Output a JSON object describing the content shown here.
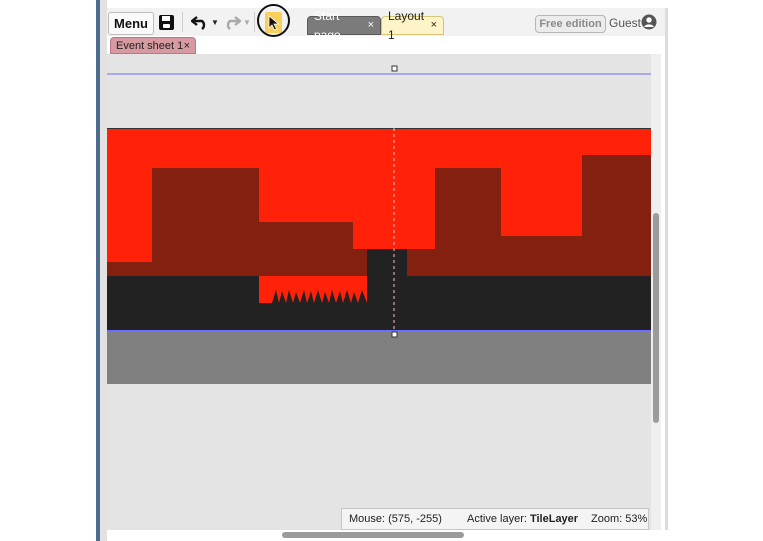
{
  "toolbar": {
    "menu_label": "Menu",
    "tabs": [
      {
        "label": "Start page",
        "close": "×"
      },
      {
        "label": "Layout 1",
        "close": "×"
      }
    ],
    "edition_badge": "Free edition",
    "user_label": "Guest"
  },
  "sheet_tabs": [
    {
      "label": "Event sheet 1",
      "close": "×"
    }
  ],
  "status": {
    "mouse": "Mouse: (575, -255)",
    "active_layer_label": "Active layer: ",
    "active_layer_value": "TileLayer",
    "zoom": "Zoom: 53%"
  },
  "icons": {
    "save": "save-icon",
    "undo": "undo-icon",
    "redo": "redo-icon",
    "pointer": "pointer-icon",
    "user": "user-icon"
  },
  "colors": {
    "sky_red": "#ff2108",
    "building_dark_red": "#84200f",
    "ground_black": "#222222",
    "floor_gray": "#808080",
    "selected_tab": "#fff4c7",
    "event_sheet_tab": "#d69aa0",
    "accent_pointer": "#f7cf5b"
  }
}
